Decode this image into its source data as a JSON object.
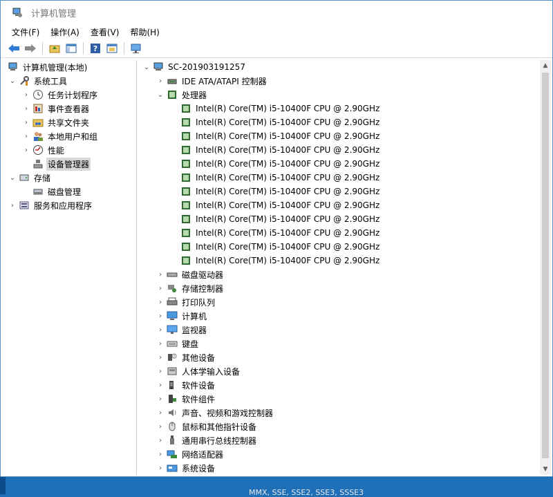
{
  "window": {
    "title": "计算机管理"
  },
  "menu": [
    "文件(F)",
    "操作(A)",
    "查看(V)",
    "帮助(H)"
  ],
  "left_tree": {
    "root": "计算机管理(本地)",
    "system_tools": "系统工具",
    "items": [
      "任务计划程序",
      "事件查看器",
      "共享文件夹",
      "本地用户和组",
      "性能",
      "设备管理器"
    ],
    "storage": "存储",
    "disk_mgmt": "磁盘管理",
    "services": "服务和应用程序"
  },
  "device_tree": {
    "computer_name": "SC-201903191257",
    "ide": "IDE ATA/ATAPI 控制器",
    "processor": "处理器",
    "cpus": [
      "Intel(R) Core(TM) i5-10400F CPU @ 2.90GHz",
      "Intel(R) Core(TM) i5-10400F CPU @ 2.90GHz",
      "Intel(R) Core(TM) i5-10400F CPU @ 2.90GHz",
      "Intel(R) Core(TM) i5-10400F CPU @ 2.90GHz",
      "Intel(R) Core(TM) i5-10400F CPU @ 2.90GHz",
      "Intel(R) Core(TM) i5-10400F CPU @ 2.90GHz",
      "Intel(R) Core(TM) i5-10400F CPU @ 2.90GHz",
      "Intel(R) Core(TM) i5-10400F CPU @ 2.90GHz",
      "Intel(R) Core(TM) i5-10400F CPU @ 2.90GHz",
      "Intel(R) Core(TM) i5-10400F CPU @ 2.90GHz",
      "Intel(R) Core(TM) i5-10400F CPU @ 2.90GHz",
      "Intel(R) Core(TM) i5-10400F CPU @ 2.90GHz"
    ],
    "categories": [
      {
        "label": "磁盘驱动器",
        "icon": "disk-drive-icon"
      },
      {
        "label": "存储控制器",
        "icon": "storage-controller-icon"
      },
      {
        "label": "打印队列",
        "icon": "printer-icon"
      },
      {
        "label": "计算机",
        "icon": "computer-icon"
      },
      {
        "label": "监视器",
        "icon": "monitor-icon"
      },
      {
        "label": "键盘",
        "icon": "keyboard-icon"
      },
      {
        "label": "其他设备",
        "icon": "unknown-device-icon"
      },
      {
        "label": "人体学输入设备",
        "icon": "hid-icon"
      },
      {
        "label": "软件设备",
        "icon": "software-device-icon"
      },
      {
        "label": "软件组件",
        "icon": "software-component-icon"
      },
      {
        "label": "声音、视频和游戏控制器",
        "icon": "speaker-icon"
      },
      {
        "label": "鼠标和其他指针设备",
        "icon": "mouse-icon"
      },
      {
        "label": "通用串行总线控制器",
        "icon": "usb-icon"
      },
      {
        "label": "网络适配器",
        "icon": "network-adapter-icon"
      },
      {
        "label": "系统设备",
        "icon": "system-device-icon"
      }
    ]
  },
  "taskbar_text": "MMX, SSE, SSE2, SSE3, SSSE3"
}
